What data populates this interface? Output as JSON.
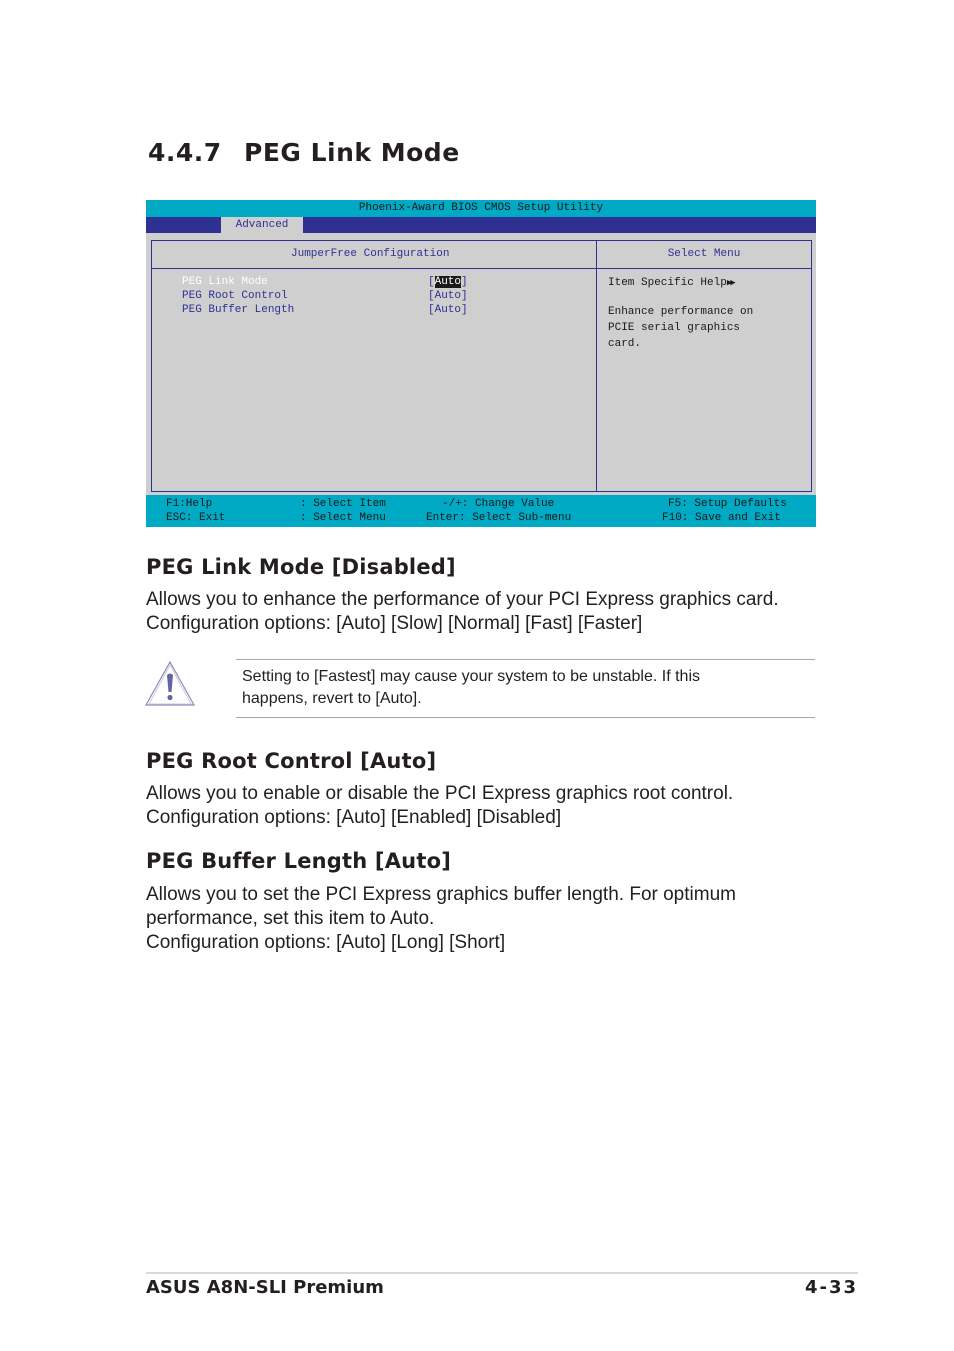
{
  "section": {
    "number": "4.4.7",
    "title": "PEG Link Mode"
  },
  "bios": {
    "title": "Phoenix-Award BIOS CMOS Setup Utility",
    "tab": "Advanced",
    "left_header": "JumperFree Configuration",
    "right_header": "Select Menu",
    "items": [
      {
        "label": "PEG Link Mode",
        "value": "Auto",
        "selected": true
      },
      {
        "label": "PEG Root Control",
        "value": "Auto",
        "selected": false
      },
      {
        "label": "PEG Buffer Length",
        "value": "Auto",
        "selected": false
      }
    ],
    "help": {
      "title": "Item Specific Help",
      "lines": [
        "Enhance performance on",
        "PCIE serial graphics",
        "card."
      ]
    },
    "status": {
      "f1": "F1:Help",
      "f1_desc": ": Select Item",
      "esc": "ESC: Exit",
      "esc_desc": ": Select Menu",
      "pm": "-/+: Change Value",
      "enter": "Enter: Select Sub-menu",
      "f5": "F5: Setup Defaults",
      "f10": "F10: Save and Exit"
    },
    "colors": {
      "cyan": "#00a9c4",
      "navy": "#2e3192",
      "panel": "#cfcfcf"
    }
  },
  "sections": [
    {
      "heading": "PEG Link Mode [Disabled]",
      "lines": [
        "Allows you to enhance the performance of your PCI Express graphics card.",
        "Configuration options: [Auto] [Slow] [Normal] [Fast] [Faster]"
      ]
    },
    {
      "heading": "PEG Root Control [Auto]",
      "lines": [
        "Allows you to enable or disable the PCI Express graphics root control.",
        "Configuration options: [Auto] [Enabled] [Disabled]"
      ]
    },
    {
      "heading": "PEG Buffer Length [Auto]",
      "lines": [
        "Allows you to set the PCI Express graphics buffer length. For optimum",
        "performance, set this item to Auto.",
        "Configuration options: [Auto] [Long] [Short]"
      ]
    }
  ],
  "note": {
    "icon": "warning-icon",
    "lines": [
      "Setting to [Fastest] may cause your system to be unstable. If this",
      "happens, revert to [Auto]."
    ]
  },
  "footer": {
    "product": "ASUS A8N-SLI Premium",
    "page": "4-33"
  }
}
